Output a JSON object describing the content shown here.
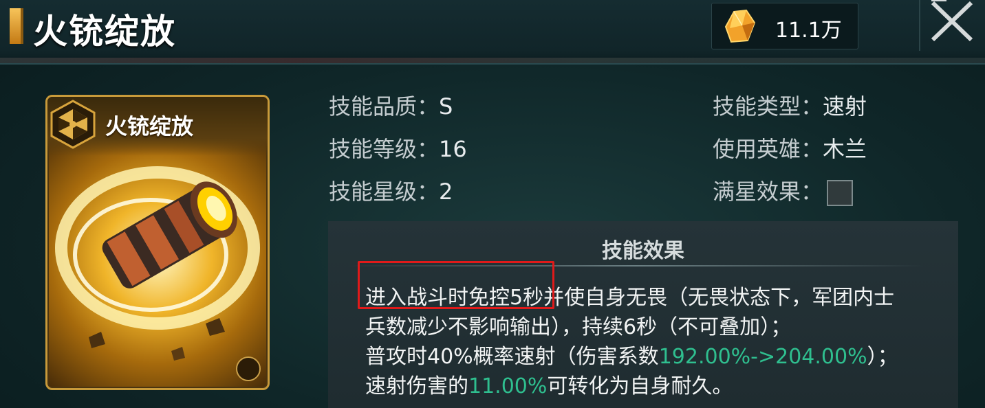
{
  "header": {
    "title": "火铳绽放",
    "currency": {
      "icon": "orange-crystal-icon",
      "value": "11.1万"
    },
    "close_icon": "close-x-icon"
  },
  "card": {
    "title": "火铳绽放",
    "icon": "hexagon-skill-icon",
    "art": "cannon-barrel-artwork"
  },
  "info": {
    "quality": {
      "label": "技能品质：",
      "value": "S"
    },
    "level": {
      "label": "技能等级：",
      "value": "16"
    },
    "star": {
      "label": "技能星级：",
      "value": "2"
    },
    "type": {
      "label": "技能类型：",
      "value": "速射"
    },
    "hero": {
      "label": "使用英雄：",
      "value": "木兰"
    },
    "full_star": {
      "label": "满星效果："
    }
  },
  "effect": {
    "title": "技能效果",
    "line1": "进入战斗时免控5秒并使自身无畏（无畏状态下，军团内士",
    "line2": "兵数减少不影响输出），持续6秒（不可叠加）；",
    "line3_a": "普攻时40%概率速射（伤害系数",
    "line3_green": "192.00%->204.00%",
    "line3_b": "）；",
    "line4_a": "速射伤害的",
    "line4_green": "11.00%",
    "line4_b": "可转化为自身耐久。"
  },
  "colors": {
    "accent_gold": "#f0b52a",
    "value_green": "#2fbf8f",
    "highlight_red": "#e01a1a"
  }
}
